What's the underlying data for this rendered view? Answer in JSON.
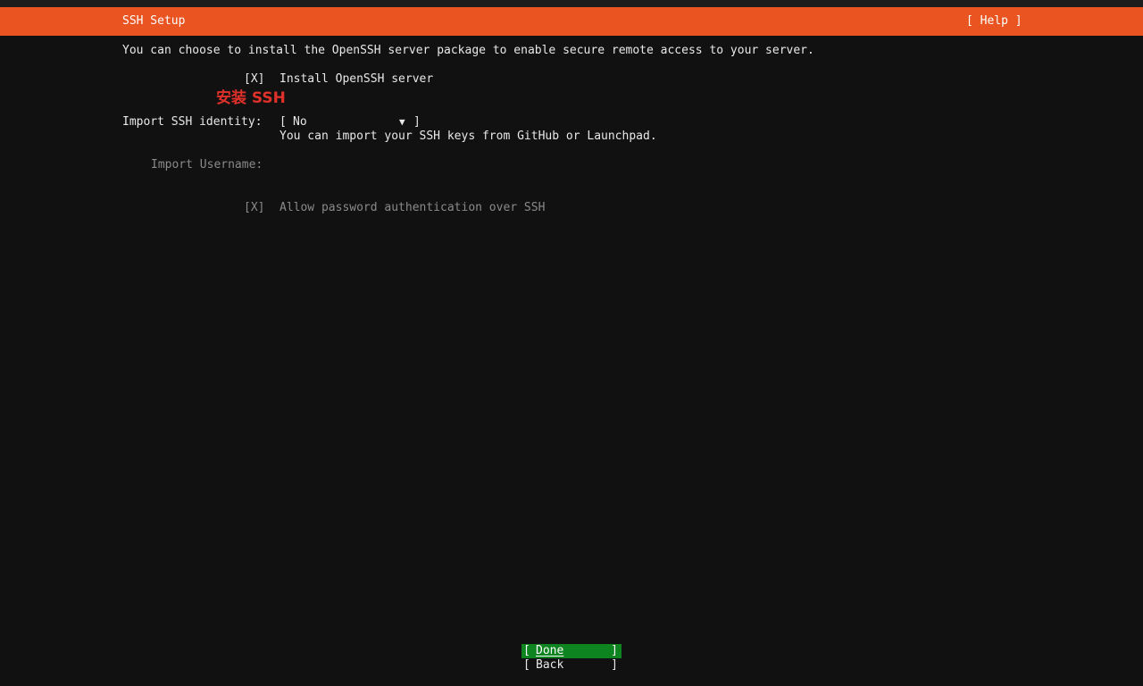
{
  "header": {
    "title": "SSH Setup",
    "help_label": "[ Help ]",
    "color": "#e95420"
  },
  "intro": "You can choose to install the OpenSSH server package to enable secure remote access to your server.",
  "install_openssh": {
    "checkbox": "[X]",
    "label": "Install OpenSSH server"
  },
  "annotation": "安装 SSH",
  "import_identity": {
    "label": "Import SSH identity:",
    "bracket_open": "[",
    "value": "No",
    "arrow": "▼",
    "bracket_close": "]",
    "help": "You can import your SSH keys from GitHub or Launchpad."
  },
  "import_username": {
    "label": "Import Username:",
    "value": ""
  },
  "allow_password": {
    "checkbox": "[X]",
    "label": "Allow password authentication over SSH"
  },
  "buttons": {
    "bracket_open": "[",
    "bracket_close": "]",
    "done": "Done",
    "back": "Back",
    "done_color": "#0e8420"
  }
}
